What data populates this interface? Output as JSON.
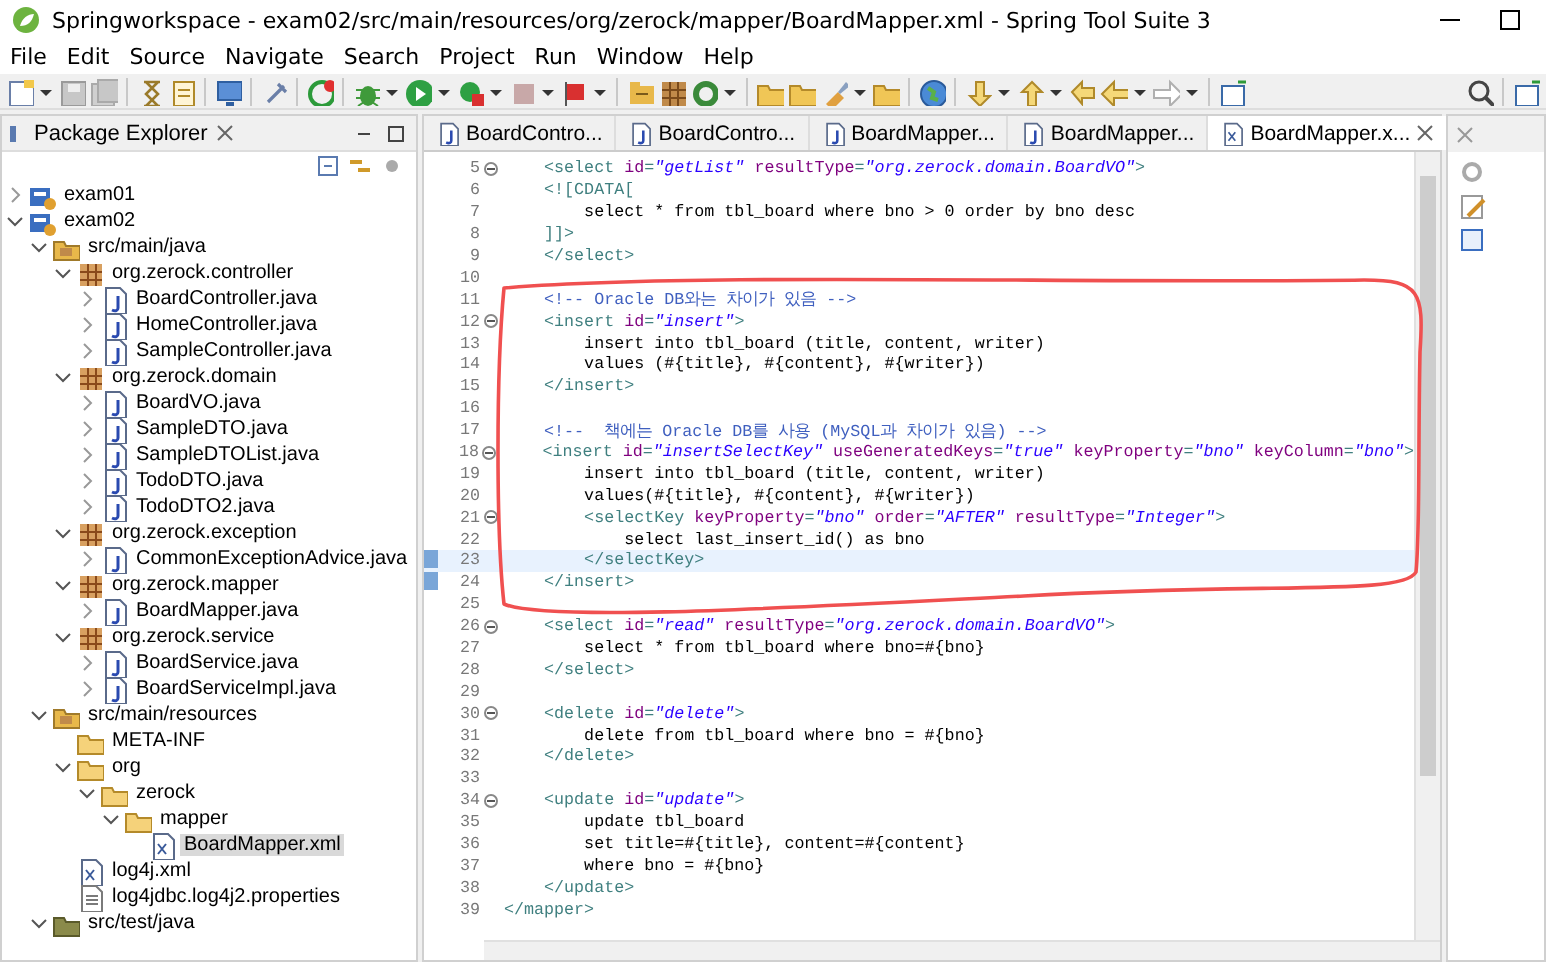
{
  "window": {
    "title": "Springworkspace - exam02/src/main/resources/org/zerock/mapper/BoardMapper.xml - Spring Tool Suite 3"
  },
  "menu": [
    "File",
    "Edit",
    "Source",
    "Navigate",
    "Search",
    "Project",
    "Run",
    "Window",
    "Help"
  ],
  "explorer": {
    "title": "Package Explorer",
    "tree": [
      {
        "label": "exam01",
        "kind": "project",
        "expanded": false,
        "selected": false
      },
      {
        "label": "exam02",
        "kind": "project",
        "expanded": true,
        "selected": false,
        "children": [
          {
            "label": "src/main/java",
            "kind": "source",
            "expanded": true,
            "selected": false,
            "children": [
              {
                "label": "org.zerock.controller",
                "kind": "package",
                "expanded": true,
                "selected": false,
                "children": [
                  {
                    "label": "BoardController.java",
                    "kind": "java",
                    "expanded": false,
                    "selected": false
                  },
                  {
                    "label": "HomeController.java",
                    "kind": "java",
                    "expanded": false,
                    "selected": false
                  },
                  {
                    "label": "SampleController.java",
                    "kind": "java",
                    "expanded": false,
                    "selected": false
                  }
                ]
              },
              {
                "label": "org.zerock.domain",
                "kind": "package",
                "expanded": true,
                "selected": false,
                "children": [
                  {
                    "label": "BoardVO.java",
                    "kind": "java",
                    "expanded": false,
                    "selected": false
                  },
                  {
                    "label": "SampleDTO.java",
                    "kind": "java",
                    "expanded": false,
                    "selected": false
                  },
                  {
                    "label": "SampleDTOList.java",
                    "kind": "java",
                    "expanded": false,
                    "selected": false
                  },
                  {
                    "label": "TodoDTO.java",
                    "kind": "java",
                    "expanded": false,
                    "selected": false
                  },
                  {
                    "label": "TodoDTO2.java",
                    "kind": "java",
                    "expanded": false,
                    "selected": false
                  }
                ]
              },
              {
                "label": "org.zerock.exception",
                "kind": "package",
                "expanded": true,
                "selected": false,
                "children": [
                  {
                    "label": "CommonExceptionAdvice.java",
                    "kind": "java",
                    "expanded": false,
                    "selected": false
                  }
                ]
              },
              {
                "label": "org.zerock.mapper",
                "kind": "package",
                "expanded": true,
                "selected": false,
                "children": [
                  {
                    "label": "BoardMapper.java",
                    "kind": "java",
                    "expanded": false,
                    "selected": false
                  }
                ]
              },
              {
                "label": "org.zerock.service",
                "kind": "package",
                "expanded": true,
                "selected": false,
                "children": [
                  {
                    "label": "BoardService.java",
                    "kind": "java",
                    "expanded": false,
                    "selected": false
                  },
                  {
                    "label": "BoardServiceImpl.java",
                    "kind": "java",
                    "expanded": false,
                    "selected": false
                  }
                ]
              }
            ]
          },
          {
            "label": "src/main/resources",
            "kind": "source",
            "expanded": true,
            "selected": false,
            "children": [
              {
                "label": "META-INF",
                "kind": "folder",
                "selected": false
              },
              {
                "label": "org",
                "kind": "folder",
                "expanded": true,
                "selected": false,
                "children": [
                  {
                    "label": "zerock",
                    "kind": "folder",
                    "expanded": true,
                    "selected": false,
                    "children": [
                      {
                        "label": "mapper",
                        "kind": "folder",
                        "expanded": true,
                        "selected": false,
                        "children": [
                          {
                            "label": "BoardMapper.xml",
                            "kind": "xml",
                            "selected": true
                          }
                        ]
                      }
                    ]
                  }
                ]
              },
              {
                "label": "log4j.xml",
                "kind": "xml",
                "selected": false
              },
              {
                "label": "log4jdbc.log4j2.properties",
                "kind": "text",
                "selected": false
              }
            ]
          },
          {
            "label": "src/test/java",
            "kind": "testsource",
            "expanded": true,
            "selected": false
          }
        ]
      }
    ]
  },
  "editor": {
    "tabs": [
      {
        "label": "BoardContro...",
        "kind": "java",
        "selected": false
      },
      {
        "label": "BoardContro...",
        "kind": "java",
        "selected": false
      },
      {
        "label": "BoardMapper...",
        "kind": "java",
        "selected": false
      },
      {
        "label": "BoardMapper...",
        "kind": "java",
        "selected": false
      },
      {
        "label": "BoardMapper.x...",
        "kind": "xml",
        "selected": true
      }
    ],
    "lines": [
      {
        "number": "5",
        "fold": true,
        "current": false,
        "segments": [
          {
            "kind": "tag",
            "text": "    <select "
          },
          {
            "kind": "attr",
            "text": "id"
          },
          {
            "kind": "tag",
            "text": "="
          },
          {
            "kind": "value",
            "text": "\"getList\""
          },
          {
            "kind": "attr",
            "text": " resultType"
          },
          {
            "kind": "tag",
            "text": "="
          },
          {
            "kind": "value",
            "text": "\"org.zerock.domain.BoardVO\""
          },
          {
            "kind": "tag",
            "text": ">"
          }
        ]
      },
      {
        "number": "6",
        "fold": false,
        "current": false,
        "segments": [
          {
            "kind": "tag",
            "text": "    <![CDATA["
          }
        ]
      },
      {
        "number": "7",
        "fold": false,
        "current": false,
        "segments": [
          {
            "kind": "plain",
            "text": "        select * from tbl_board where bno > 0 order by bno desc"
          }
        ]
      },
      {
        "number": "8",
        "fold": false,
        "current": false,
        "segments": [
          {
            "kind": "tag",
            "text": "    ]]>"
          }
        ]
      },
      {
        "number": "9",
        "fold": false,
        "current": false,
        "segments": [
          {
            "kind": "tag",
            "text": "    </select>"
          }
        ]
      },
      {
        "number": "10",
        "fold": false,
        "current": false
      },
      {
        "number": "11",
        "fold": false,
        "current": false,
        "segments": [
          {
            "kind": "comment",
            "text": "    <!-- Oracle DB와는 차이가 있음 -->"
          }
        ]
      },
      {
        "number": "12",
        "fold": true,
        "current": false,
        "segments": [
          {
            "kind": "tag",
            "text": "    <insert "
          },
          {
            "kind": "attr",
            "text": "id"
          },
          {
            "kind": "tag",
            "text": "="
          },
          {
            "kind": "value",
            "text": "\"insert\""
          },
          {
            "kind": "tag",
            "text": ">"
          }
        ]
      },
      {
        "number": "13",
        "fold": false,
        "current": false,
        "segments": [
          {
            "kind": "plain",
            "text": "        insert into tbl_board (title, content, writer)"
          }
        ]
      },
      {
        "number": "14",
        "fold": false,
        "current": false,
        "segments": [
          {
            "kind": "plain",
            "text": "        values (#{title}, #{content}, #{writer})"
          }
        ]
      },
      {
        "number": "15",
        "fold": false,
        "current": false,
        "segments": [
          {
            "kind": "tag",
            "text": "    </insert>"
          }
        ]
      },
      {
        "number": "16",
        "fold": false,
        "current": false
      },
      {
        "number": "17",
        "fold": false,
        "current": false,
        "segments": [
          {
            "kind": "comment",
            "text": "    <!--  책에는 Oracle DB를 사용 (MySQL과 차이가 있음) -->"
          }
        ]
      },
      {
        "number": "18",
        "fold": true,
        "current": false,
        "segments": [
          {
            "kind": "tag",
            "text": "    <insert "
          },
          {
            "kind": "attr",
            "text": "id"
          },
          {
            "kind": "tag",
            "text": "="
          },
          {
            "kind": "value",
            "text": "\"insertSelectKey\""
          },
          {
            "kind": "attr",
            "text": " useGeneratedKeys"
          },
          {
            "kind": "tag",
            "text": "="
          },
          {
            "kind": "value",
            "text": "\"true\""
          },
          {
            "kind": "attr",
            "text": " keyProperty"
          },
          {
            "kind": "tag",
            "text": "="
          },
          {
            "kind": "value",
            "text": "\"bno\""
          },
          {
            "kind": "attr",
            "text": " keyColumn"
          },
          {
            "kind": "tag",
            "text": "="
          },
          {
            "kind": "value",
            "text": "\"bno\""
          },
          {
            "kind": "tag",
            "text": ">"
          }
        ]
      },
      {
        "number": "19",
        "fold": false,
        "current": false,
        "segments": [
          {
            "kind": "plain",
            "text": "        insert into tbl_board (title, content, writer)"
          }
        ]
      },
      {
        "number": "20",
        "fold": false,
        "current": false,
        "segments": [
          {
            "kind": "plain",
            "text": "        values(#{title}, #{content}, #{writer})"
          }
        ]
      },
      {
        "number": "21",
        "fold": true,
        "current": false,
        "segments": [
          {
            "kind": "tag",
            "text": "        <selectKey "
          },
          {
            "kind": "attr",
            "text": "keyProperty"
          },
          {
            "kind": "tag",
            "text": "="
          },
          {
            "kind": "value",
            "text": "\"bno\""
          },
          {
            "kind": "attr",
            "text": " order"
          },
          {
            "kind": "tag",
            "text": "="
          },
          {
            "kind": "value",
            "text": "\"AFTER\""
          },
          {
            "kind": "attr",
            "text": " resultType"
          },
          {
            "kind": "tag",
            "text": "="
          },
          {
            "kind": "value",
            "text": "\"Integer\""
          },
          {
            "kind": "tag",
            "text": ">"
          }
        ]
      },
      {
        "number": "22",
        "fold": false,
        "current": false,
        "segments": [
          {
            "kind": "plain",
            "text": "            select last_insert_id() as bno"
          }
        ]
      },
      {
        "number": "23",
        "fold": false,
        "current": true,
        "segments": [
          {
            "kind": "tag",
            "text": "        </selectKey>"
          }
        ]
      },
      {
        "number": "24",
        "fold": false,
        "current": false,
        "segments": [
          {
            "kind": "tag",
            "text": "    </insert>"
          }
        ]
      },
      {
        "number": "25",
        "fold": false,
        "current": false
      },
      {
        "number": "26",
        "fold": true,
        "current": false,
        "segments": [
          {
            "kind": "tag",
            "text": "    <select "
          },
          {
            "kind": "attr",
            "text": "id"
          },
          {
            "kind": "tag",
            "text": "="
          },
          {
            "kind": "value",
            "text": "\"read\""
          },
          {
            "kind": "attr",
            "text": " resultType"
          },
          {
            "kind": "tag",
            "text": "="
          },
          {
            "kind": "value",
            "text": "\"org.zerock.domain.BoardVO\""
          },
          {
            "kind": "tag",
            "text": ">"
          }
        ]
      },
      {
        "number": "27",
        "fold": false,
        "current": false,
        "segments": [
          {
            "kind": "plain",
            "text": "        select * from tbl_board where bno=#{bno}"
          }
        ]
      },
      {
        "number": "28",
        "fold": false,
        "current": false,
        "segments": [
          {
            "kind": "tag",
            "text": "    </select>"
          }
        ]
      },
      {
        "number": "29",
        "fold": false,
        "current": false
      },
      {
        "number": "30",
        "fold": true,
        "current": false,
        "segments": [
          {
            "kind": "tag",
            "text": "    <delete "
          },
          {
            "kind": "attr",
            "text": "id"
          },
          {
            "kind": "tag",
            "text": "="
          },
          {
            "kind": "value",
            "text": "\"delete\""
          },
          {
            "kind": "tag",
            "text": ">"
          }
        ]
      },
      {
        "number": "31",
        "fold": false,
        "current": false,
        "segments": [
          {
            "kind": "plain",
            "text": "        delete from tbl_board where bno = #{bno}"
          }
        ]
      },
      {
        "number": "32",
        "fold": false,
        "current": false,
        "segments": [
          {
            "kind": "tag",
            "text": "    </delete>"
          }
        ]
      },
      {
        "number": "33",
        "fold": false,
        "current": false
      },
      {
        "number": "34",
        "fold": true,
        "current": false,
        "segments": [
          {
            "kind": "tag",
            "text": "    <update "
          },
          {
            "kind": "attr",
            "text": "id"
          },
          {
            "kind": "tag",
            "text": "="
          },
          {
            "kind": "value",
            "text": "\"update\""
          },
          {
            "kind": "tag",
            "text": ">"
          }
        ]
      },
      {
        "number": "35",
        "fold": false,
        "current": false,
        "segments": [
          {
            "kind": "plain",
            "text": "        update tbl_board"
          }
        ]
      },
      {
        "number": "36",
        "fold": false,
        "current": false,
        "segments": [
          {
            "kind": "plain",
            "text": "        set title=#{title}, content=#{content}"
          }
        ]
      },
      {
        "number": "37",
        "fold": false,
        "current": false,
        "segments": [
          {
            "kind": "plain",
            "text": "        where bno = #{bno}"
          }
        ]
      },
      {
        "number": "38",
        "fold": false,
        "current": false,
        "segments": [
          {
            "kind": "tag",
            "text": "    </update>"
          }
        ]
      },
      {
        "number": "39",
        "fold": false,
        "current": false,
        "segments": [
          {
            "kind": "tag",
            "text": "</mapper>"
          }
        ]
      }
    ]
  }
}
